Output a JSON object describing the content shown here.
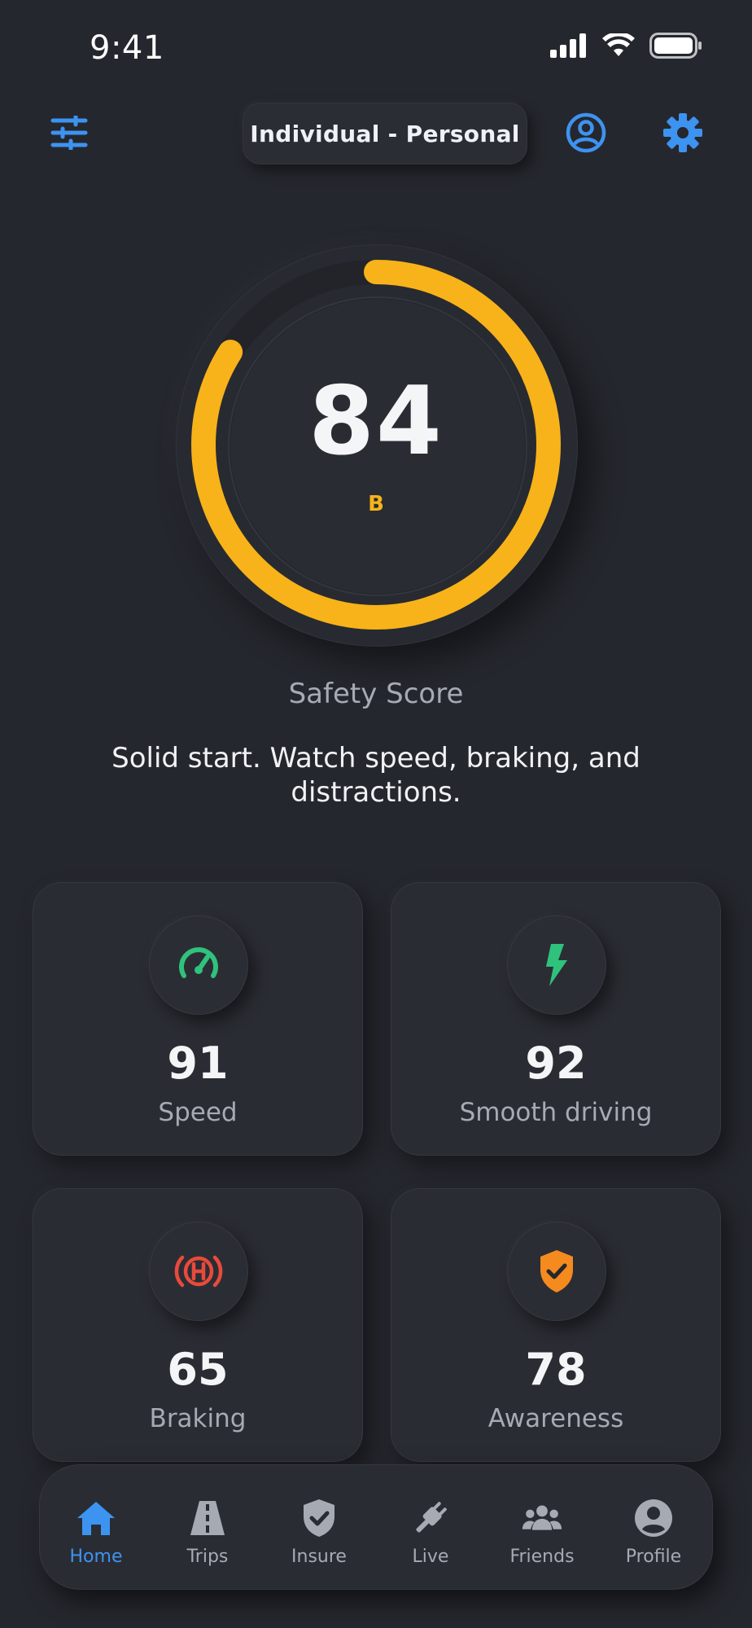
{
  "status_bar": {
    "time": "9:41"
  },
  "header": {
    "account_label": "Individual - Personal"
  },
  "score": {
    "value": "84",
    "grade": "B",
    "fraction": 0.84,
    "label": "Safety Score",
    "message": "Solid start. Watch speed, braking, and distractions.",
    "color": "#f7b319"
  },
  "metrics": [
    {
      "value": "91",
      "label": "Speed",
      "icon": "speedometer-icon",
      "color": "#2fc27c"
    },
    {
      "value": "92",
      "label": "Smooth driving",
      "icon": "lightning-icon",
      "color": "#2fc27c"
    },
    {
      "value": "65",
      "label": "Braking",
      "icon": "brake-warning-icon",
      "color": "#e84a3b"
    },
    {
      "value": "78",
      "label": "Awareness",
      "icon": "shield-check-icon",
      "color": "#f58a1f"
    }
  ],
  "nav": {
    "items": [
      {
        "label": "Home",
        "icon": "home-icon",
        "active": true
      },
      {
        "label": "Trips",
        "icon": "road-icon"
      },
      {
        "label": "Insure",
        "icon": "shield-icon"
      },
      {
        "label": "Live",
        "icon": "plug-icon"
      },
      {
        "label": "Friends",
        "icon": "friends-icon"
      },
      {
        "label": "Profile",
        "icon": "profile-icon"
      }
    ],
    "accent": "#3d93f0",
    "inactive_color": "#a6aab3"
  }
}
